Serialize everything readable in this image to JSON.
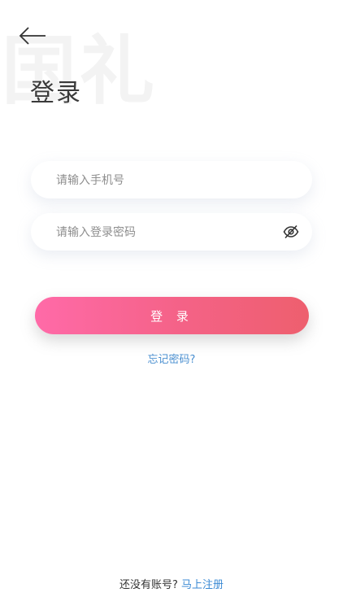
{
  "watermark": {
    "text": "国礼"
  },
  "header": {
    "title": "登录"
  },
  "form": {
    "phone_placeholder": "请输入手机号",
    "password_placeholder": "请输入登录密码",
    "login_label": "登 录",
    "forgot_label": "忘记密码?"
  },
  "footer": {
    "prompt": "还没有账号?",
    "register_label": "马上注册"
  },
  "icons": {
    "back": "arrow-left-icon",
    "password_visibility": "eye-off-icon"
  },
  "colors": {
    "button_gradient_start": "#ff6aa8",
    "button_gradient_end": "#ee5f6e",
    "link": "#4a8fd0"
  }
}
